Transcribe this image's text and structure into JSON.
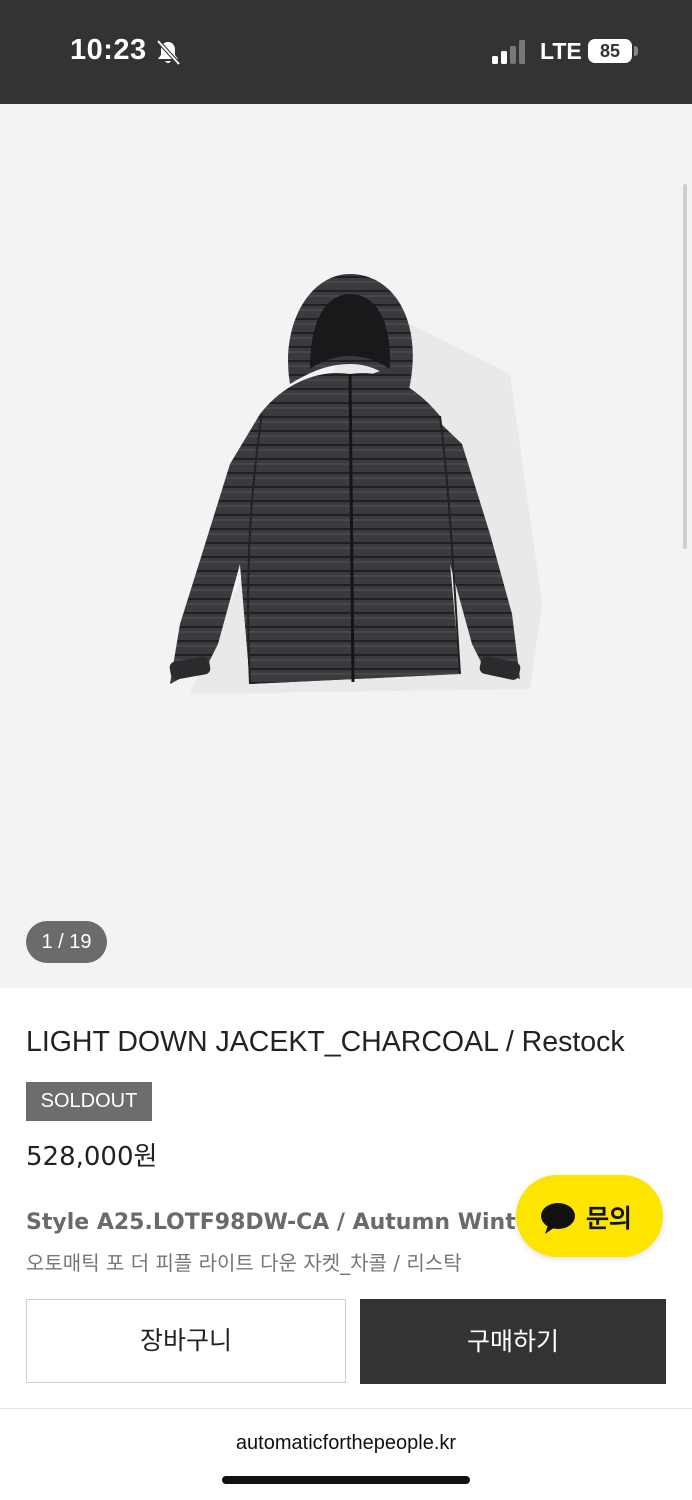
{
  "status_bar": {
    "time": "10:23",
    "network": "LTE",
    "battery": "85",
    "icons": [
      "bell-slash-icon",
      "signal-icon"
    ]
  },
  "gallery": {
    "page_indicator": "1 / 19",
    "image_subject": "jacket-image"
  },
  "product": {
    "title": "LIGHT DOWN JACEKT_CHARCOAL / Restock",
    "badge": "SOLDOUT",
    "price": "528,000원",
    "style_line": "Style A25.LOTF98DW-CA / Autumn Winter 2025",
    "korean_name": "오토매틱 포 더 피플 라이트 다운 자켓_차콜 / 리스탁"
  },
  "chat": {
    "label": "문의",
    "color": "#FEE500"
  },
  "actions": {
    "cart_label": "장바구니",
    "buy_label": "구매하기"
  },
  "browser": {
    "url": "automaticforthepeople.kr"
  }
}
